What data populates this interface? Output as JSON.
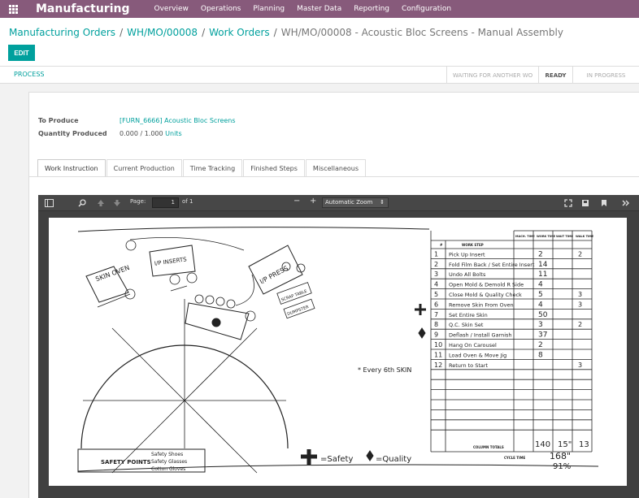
{
  "navbar": {
    "app_title": "Manufacturing",
    "menu": [
      "Overview",
      "Operations",
      "Planning",
      "Master Data",
      "Reporting",
      "Configuration"
    ]
  },
  "breadcrumb": {
    "items": [
      "Manufacturing Orders",
      "WH/MO/00008",
      "Work Orders"
    ],
    "current": "WH/MO/00008 - Acoustic Bloc Screens - Manual Assembly",
    "separator": "/"
  },
  "buttons": {
    "edit": "EDIT",
    "process": "PROCESS"
  },
  "statusbar": {
    "stages": [
      "WAITING FOR ANOTHER WO",
      "READY",
      "IN PROGRESS"
    ],
    "active_stage": "READY"
  },
  "form": {
    "to_produce_label": "To Produce",
    "to_produce_value": "[FURN_6666] Acoustic Bloc Screens",
    "qty_label": "Quantity Produced",
    "qty_done": "0.000",
    "qty_sep": "/",
    "qty_total": "1.000",
    "qty_unit": "Units"
  },
  "tabs": [
    "Work Instruction",
    "Current Production",
    "Time Tracking",
    "Finished Steps",
    "Miscellaneous"
  ],
  "active_tab": "Work Instruction",
  "pdf_viewer": {
    "page_label": "Page:",
    "page_number": "1",
    "page_of": "of 1",
    "zoom": "Automatic Zoom",
    "zoom_minus": "−",
    "zoom_plus": "+"
  },
  "document": {
    "table_headers": [
      "#",
      "WORK STEP",
      "MACH. TIME",
      "WORK TIME",
      "WAIT TIME",
      "WALK TIME"
    ],
    "steps": [
      {
        "n": "1",
        "step": "Pick Up Insert",
        "work": "2",
        "walk": "2"
      },
      {
        "n": "2",
        "step": "Fold Film Back / Set Entire Insert",
        "work": "14",
        "walk": ""
      },
      {
        "n": "3",
        "step": "Undo All Bolts",
        "work": "11",
        "walk": ""
      },
      {
        "n": "4",
        "step": "Open Mold & Demold R Side",
        "work": "4",
        "walk": ""
      },
      {
        "n": "5",
        "step": "Close Mold & Quality Check",
        "work": "5",
        "walk": "3"
      },
      {
        "n": "6",
        "step": "Remove Skin From Oven",
        "work": "4",
        "walk": "3"
      },
      {
        "n": "7",
        "step": "Set Entire Skin",
        "work": "50",
        "walk": ""
      },
      {
        "n": "8",
        "step": "Q.C. Skin Set",
        "work": "3",
        "walk": "2"
      },
      {
        "n": "9",
        "step": "Deflash / Install Garnish",
        "work": "37",
        "walk": ""
      },
      {
        "n": "10",
        "step": "Hang On Carousel",
        "work": "2",
        "walk": ""
      },
      {
        "n": "11",
        "step": "Load Oven & Move Jig",
        "work": "8",
        "walk": ""
      },
      {
        "n": "12",
        "step": "Return to Start",
        "work": "",
        "walk": "3"
      }
    ],
    "column_totals_label": "COLUMN TOTALS",
    "totals": [
      "140",
      "15\"",
      "13"
    ],
    "cycle_time_label": "CYCLE TIME",
    "cycle_time": "168\"",
    "cycle_pct": "91%",
    "safety_points_label": "SAFETY POINTS",
    "safety_items": [
      "Safety Shoes",
      "Safety Glasses",
      "Cotton Gloves"
    ],
    "legend_safety": "=Safety",
    "legend_quality": "=Quality",
    "note": "* Every 6th SKIN",
    "stations": [
      "SKIN OVEN",
      "I/P INSERTS",
      "I/P PRESS",
      "SCRAP TABLE",
      "DUMPSTER"
    ]
  }
}
